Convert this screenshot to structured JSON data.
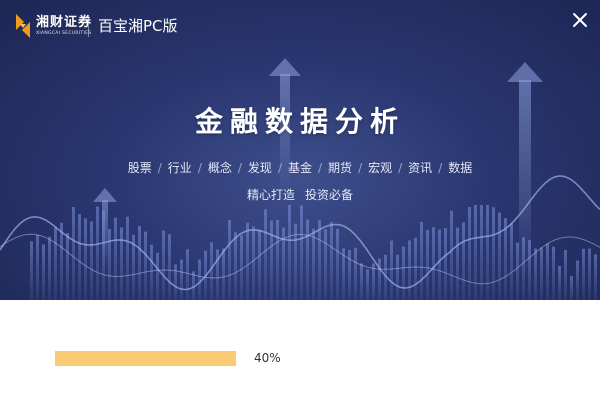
{
  "brand": {
    "name_cn": "湘财证券",
    "name_en": "XIANGCAI SECURITIES",
    "accent_color": "#f29b1b"
  },
  "window": {
    "app_name": "百宝湘PC版",
    "close_icon": "close-icon"
  },
  "banner": {
    "headline": "金融数据分析",
    "categories": [
      "股票",
      "行业",
      "概念",
      "发现",
      "基金",
      "期货",
      "宏观",
      "资讯",
      "数据"
    ],
    "slogan": [
      "精心打造",
      "投资必备"
    ],
    "background_color": "#2a3670"
  },
  "progress": {
    "percent": 40,
    "label": "40%",
    "fill_color": "#f8cb74"
  }
}
